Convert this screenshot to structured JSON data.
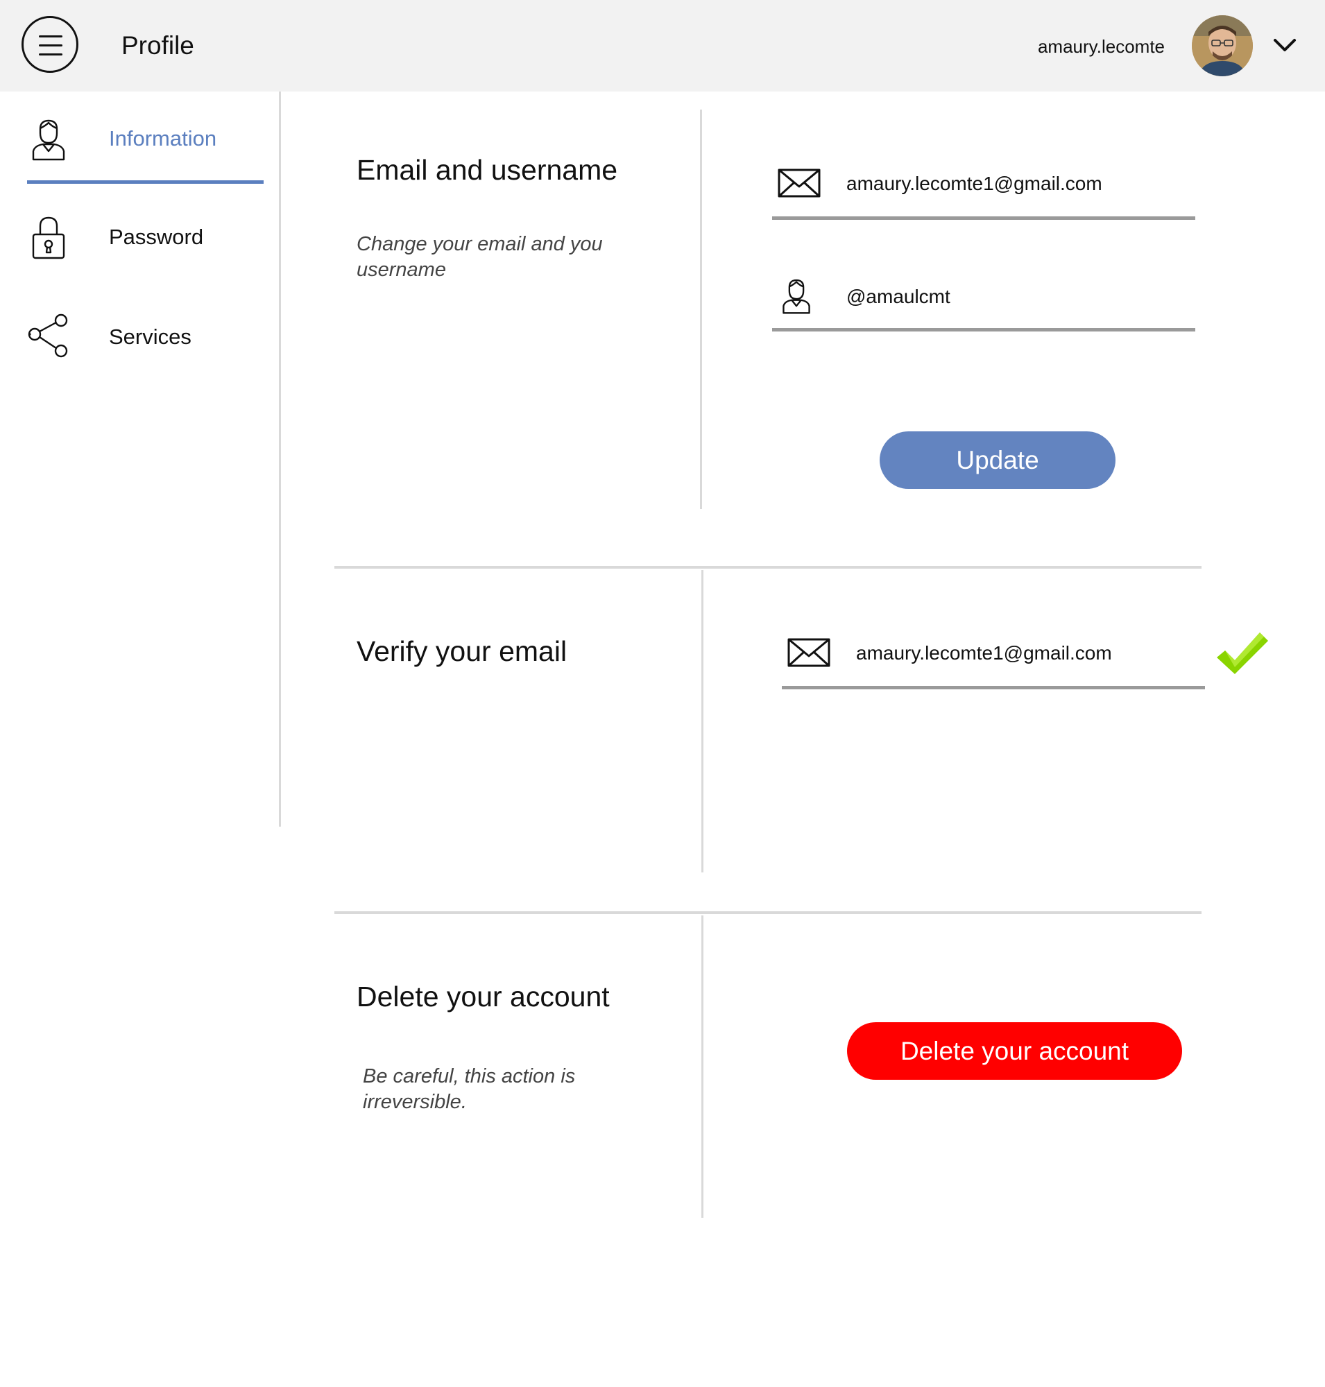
{
  "header": {
    "title": "Profile",
    "username": "amaury.lecomte",
    "menu_icon": "hamburger-menu-icon",
    "dropdown_icon": "chevron-down-icon"
  },
  "sidebar": {
    "items": [
      {
        "label": "Information",
        "icon": "user-icon",
        "active": true
      },
      {
        "label": "Password",
        "icon": "lock-icon",
        "active": false
      },
      {
        "label": "Services",
        "icon": "share-icon",
        "active": false
      }
    ]
  },
  "sections": {
    "email_username": {
      "title": "Email and username",
      "description_line1": "Change your email and you",
      "description_line2": "username",
      "email_value": "amaury.lecomte1@gmail.com",
      "username_value": "@amaulcmt",
      "button_label": "Update"
    },
    "verify": {
      "title": "Verify your email",
      "email_value": "amaury.lecomte1@gmail.com",
      "status_icon": "checkmark-icon"
    },
    "delete": {
      "title": "Delete your account",
      "description_line1": "Be careful, this action is",
      "description_line2": "irreversible.",
      "button_label": "Delete your account"
    }
  },
  "colors": {
    "accent": "#5b7fbf",
    "update_button": "#6384c0",
    "delete_button": "#ff0000",
    "verified": "#8ad400",
    "header_bg": "#f2f2f2",
    "divider": "#d9d9d9"
  }
}
